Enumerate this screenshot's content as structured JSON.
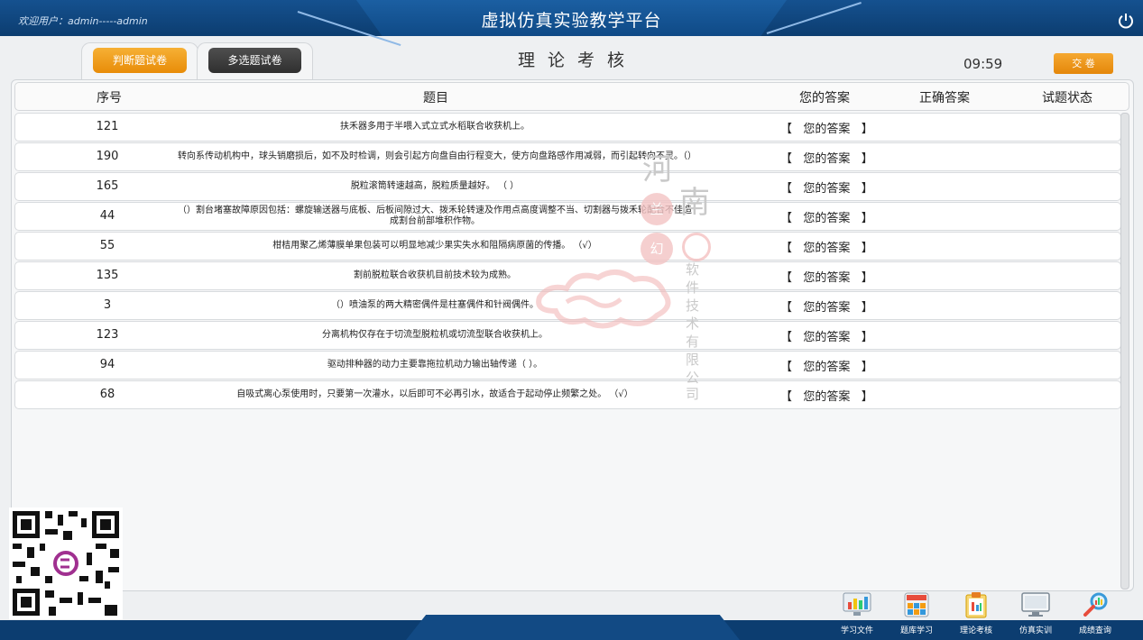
{
  "header": {
    "welcome": "欢迎用户：admin-----admin",
    "app_title": "虚拟仿真实验教学平台"
  },
  "tabs": [
    {
      "label": "判断题试卷",
      "active": true
    },
    {
      "label": "多选题试卷",
      "active": false
    }
  ],
  "exam": {
    "title": "理 论 考 核",
    "timer": "09:59",
    "submit_label": "交 卷"
  },
  "table": {
    "columns": [
      "序号",
      "题目",
      "您的答案",
      "正确答案",
      "试题状态"
    ],
    "rows": [
      {
        "no": "121",
        "question": "扶禾器多用于半喂入式立式水稻联合收获机上。",
        "answer": "【   您的答案   】"
      },
      {
        "no": "190",
        "question": "转向系传动机构中，球头销磨损后，如不及时检调，则会引起方向盘自由行程变大，使方向盘路感作用减弱，而引起转向不灵。（）",
        "answer": "【   您的答案   】"
      },
      {
        "no": "165",
        "question": "脱粒滚筒转速越高，脱粒质量越好。 （ ）",
        "answer": "【   您的答案   】"
      },
      {
        "no": "44",
        "question": "（）割台堵塞故障原因包括：螺旋输送器与底板、后板间隙过大、拨禾轮转速及作用点高度调整不当、切割器与拨禾轮配合不佳造成割台前部堆积作物。",
        "answer": "【   您的答案   】"
      },
      {
        "no": "55",
        "question": "柑桔用聚乙烯薄膜单果包装可以明显地减少果实失水和阻隔病原菌的传播。 （√）",
        "answer": "【   您的答案   】"
      },
      {
        "no": "135",
        "question": "割前脱粒联合收获机目前技术较为成熟。",
        "answer": "【   您的答案   】"
      },
      {
        "no": "3",
        "question": "（）喷油泵的两大精密偶件是柱塞偶件和针阀偶件。",
        "answer": "【   您的答案   】"
      },
      {
        "no": "123",
        "question": "分离机构仅存在于切流型脱粒机或切流型联合收获机上。",
        "answer": "【   您的答案   】"
      },
      {
        "no": "94",
        "question": "驱动排种器的动力主要靠拖拉机动力输出轴传递（ ）。",
        "answer": "【   您的答案   】"
      },
      {
        "no": "68",
        "question": "自吸式离心泵使用时，只要第一次灌水，以后即可不必再引水，故适合于起动停止频繁之处。 （√）",
        "answer": "【   您的答案   】"
      }
    ]
  },
  "watermark": {
    "chars": [
      "河",
      "南",
      "兰",
      "幻",
      "软",
      "件",
      "技",
      "术",
      "有",
      "限",
      "公",
      "司"
    ]
  },
  "bottom_nav": [
    {
      "label": "学习文件",
      "icon": "chart-monitor-icon"
    },
    {
      "label": "题库学习",
      "icon": "question-bank-icon"
    },
    {
      "label": "理论考核",
      "icon": "clipboard-icon"
    },
    {
      "label": "仿真实训",
      "icon": "monitor-icon"
    },
    {
      "label": "成绩查询",
      "icon": "search-icon"
    }
  ],
  "colors": {
    "brand_blue": "#0c3d70",
    "accent_orange": "#f0a020",
    "dark_tab": "#3a3a3a"
  }
}
